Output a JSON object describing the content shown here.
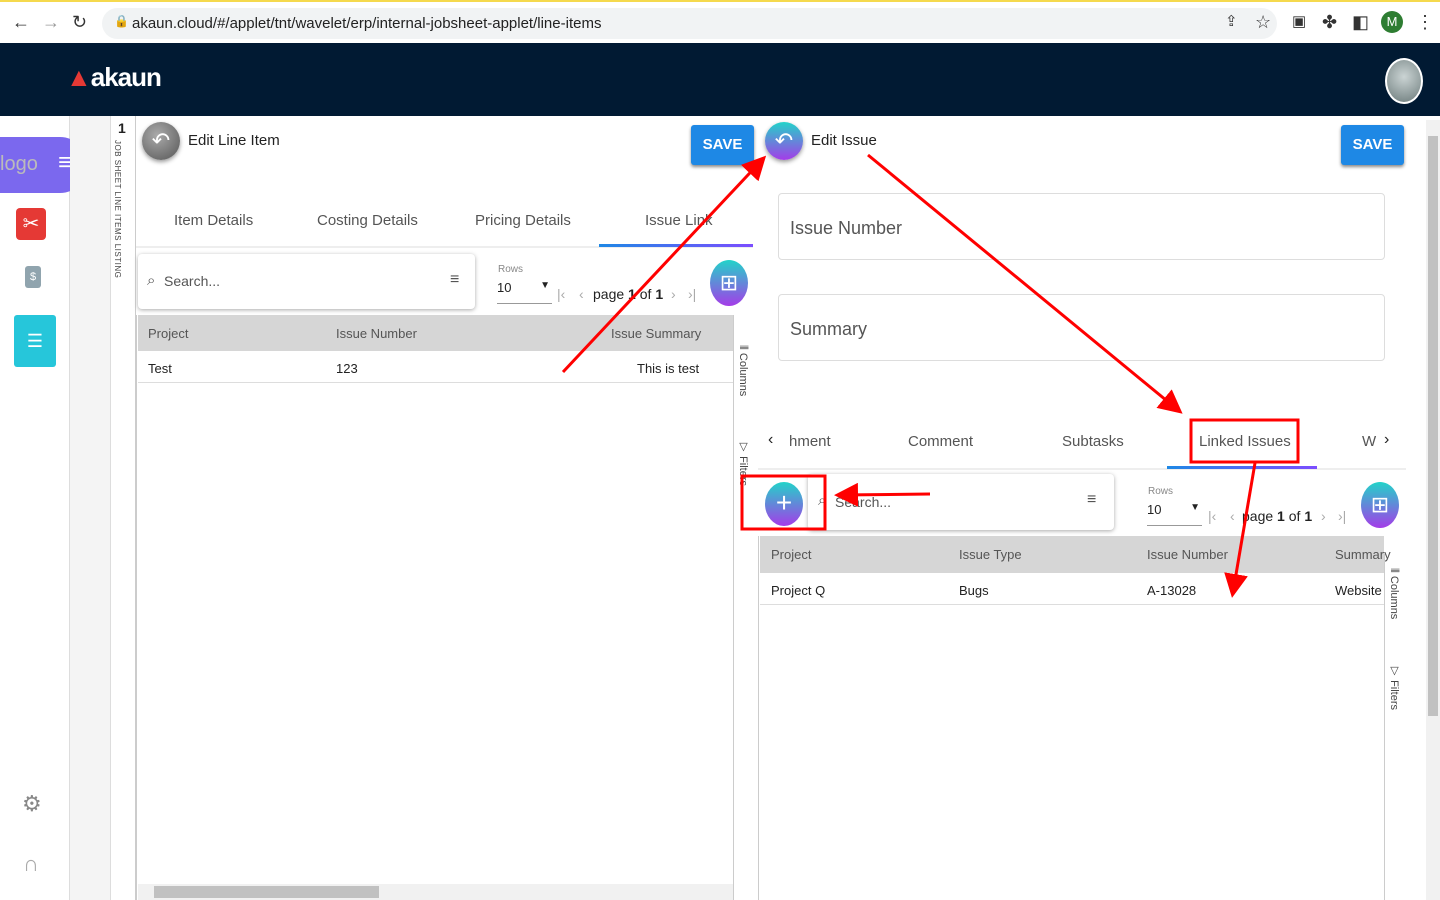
{
  "browser": {
    "url": "akaun.cloud/#/applet/tnt/wavelet/erp/internal-jobsheet-applet/line-items",
    "profile_initial": "M"
  },
  "app": {
    "brand": "akaun",
    "logo_alt": "logo"
  },
  "listing": {
    "count": "1",
    "label": "JOB SHEET LINE ITEMS LISTING"
  },
  "left": {
    "title": "Edit Line Item",
    "save": "SAVE",
    "tabs": [
      "Item Details",
      "Costing Details",
      "Pricing Details",
      "Issue Link"
    ],
    "search_placeholder": "Search...",
    "rows_label": "Rows",
    "rows_value": "10",
    "page_word": "page",
    "page": "1",
    "of_word": "of",
    "total": "1",
    "headers": [
      "Project",
      "Issue Number",
      "Issue Summary"
    ],
    "rows": [
      [
        "Test",
        "123",
        "This is test"
      ]
    ],
    "columns": "Columns",
    "filters": "Filters"
  },
  "right": {
    "title": "Edit Issue",
    "save": "SAVE",
    "issue_number_label": "Issue Number",
    "summary_label": "Summary",
    "tabs": [
      "hment",
      "Comment",
      "Subtasks",
      "Linked Issues",
      "W"
    ],
    "search_placeholder": "Search...",
    "rows_label": "Rows",
    "rows_value": "10",
    "page_word": "page",
    "page": "1",
    "of_word": "of",
    "total": "1",
    "headers": [
      "Project",
      "Issue Type",
      "Issue Number",
      "Summary"
    ],
    "rows": [
      [
        "Project Q",
        "Bugs",
        "A-13028",
        "Website b"
      ]
    ],
    "columns": "Columns",
    "filters": "Filters"
  },
  "colors": {
    "accent": "#1e88e5",
    "topbar": "#011a33",
    "annotation": "#ff0000"
  }
}
